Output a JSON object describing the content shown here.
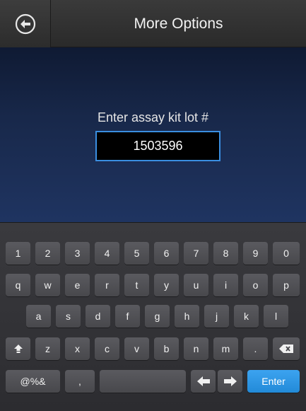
{
  "header": {
    "back_icon": "back-arrow-circle-icon",
    "title": "More Options"
  },
  "form": {
    "prompt": "Enter assay kit lot #",
    "lot_value": "1503596"
  },
  "keyboard": {
    "row1": [
      "1",
      "2",
      "3",
      "4",
      "5",
      "6",
      "7",
      "8",
      "9",
      "0"
    ],
    "row2": [
      "q",
      "w",
      "e",
      "r",
      "t",
      "y",
      "u",
      "i",
      "o",
      "p"
    ],
    "row3": [
      "a",
      "s",
      "d",
      "f",
      "g",
      "h",
      "j",
      "k",
      "l"
    ],
    "row4": [
      "z",
      "x",
      "c",
      "v",
      "b",
      "n",
      "m",
      "."
    ],
    "symbols_label": "@%&",
    "comma_label": ",",
    "enter_label": "Enter",
    "shift_icon": "shift-icon",
    "backspace_icon": "backspace-icon",
    "left_arrow_icon": "left-arrow-icon",
    "right_arrow_icon": "right-arrow-icon",
    "accent_color": "#2a95e5"
  }
}
